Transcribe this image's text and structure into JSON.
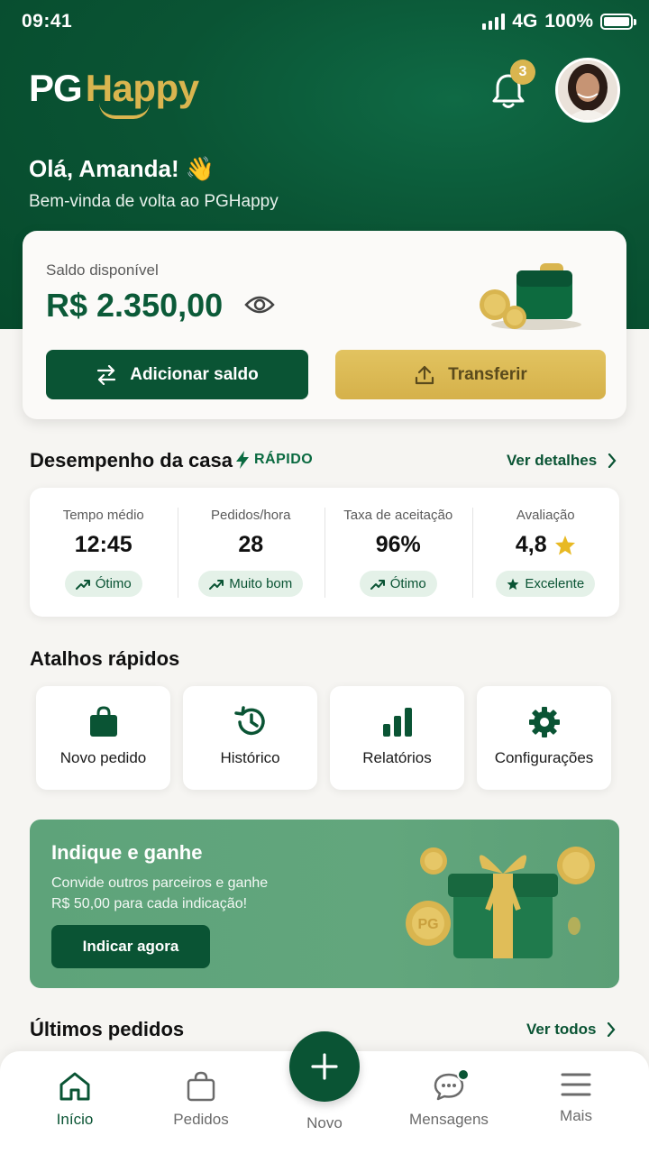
{
  "status_bar": {
    "time": "09:41",
    "network": "4G",
    "battery": "100%"
  },
  "header": {
    "logo_pg": "PG",
    "logo_happy": "Happy",
    "notifications_count": "3",
    "greeting": "Olá, Amanda! 👋",
    "subtitle": "Bem-vinda de volta ao PGHappy"
  },
  "balance": {
    "label": "Saldo disponível",
    "value": "R$ 2.350,00",
    "add_label": "Adicionar saldo",
    "transfer_label": "Transferir"
  },
  "performance": {
    "title": "Desempenho da casa",
    "badge": "RÁPIDO",
    "link": "Ver detalhes",
    "items": [
      {
        "label": "Tempo médio",
        "value": "12:45",
        "status": "Ótimo"
      },
      {
        "label": "Pedidos/hora",
        "value": "28",
        "status": "Muito bom"
      },
      {
        "label": "Taxa de aceitação",
        "value": "96%",
        "status": "Ótimo"
      },
      {
        "label": "Avaliação",
        "value": "4,8",
        "status": "Excelente"
      }
    ]
  },
  "shortcuts": {
    "title": "Atalhos rápidos",
    "items": [
      {
        "label": "Novo pedido",
        "icon": "shopping-bag-icon"
      },
      {
        "label": "Histórico",
        "icon": "history-icon"
      },
      {
        "label": "Relatórios",
        "icon": "bar-chart-icon"
      },
      {
        "label": "Configurações",
        "icon": "gear-icon"
      }
    ]
  },
  "promo": {
    "title": "Indique e ganhe",
    "text_line1": "Convide outros parceiros e ganhe",
    "text_amount": "R$ 50,00",
    "text_line2": " para cada indicação!",
    "button": "Indicar agora",
    "coin_label": "PG"
  },
  "recent": {
    "title": "Últimos pedidos",
    "link": "Ver todos"
  },
  "nav": {
    "items": [
      {
        "label": "Início"
      },
      {
        "label": "Pedidos"
      },
      {
        "label": "Novo"
      },
      {
        "label": "Mensagens"
      },
      {
        "label": "Mais"
      }
    ]
  },
  "colors": {
    "primary": "#0a5434",
    "gold": "#d9b54f",
    "promo_bg": "#5ea37a"
  }
}
